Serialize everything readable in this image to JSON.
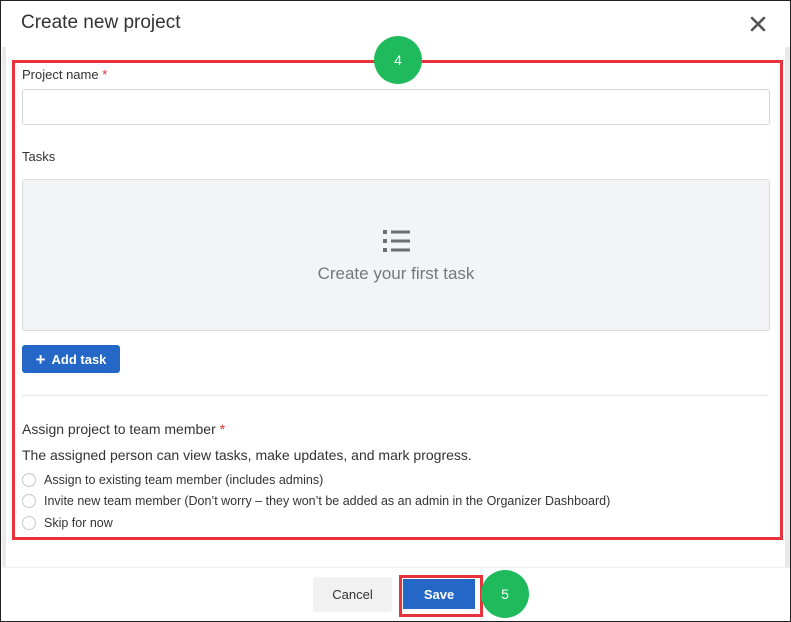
{
  "dialog": {
    "title": "Create new project",
    "close_icon": "close-icon"
  },
  "form": {
    "project_name_label": "Project name",
    "required_mark": "*",
    "project_name_value": "",
    "tasks_label": "Tasks",
    "tasks_empty_icon": "list-icon",
    "tasks_empty_text": "Create your first task",
    "add_task_label": "Add task",
    "add_task_icon": "plus-icon",
    "assign_label": "Assign project to team member",
    "assign_description": "The assigned person can view tasks, make updates, and mark progress.",
    "assign_options": [
      "Assign to existing team member (includes admins)",
      "Invite new team member (Don’t worry – they won’t be added as an admin in the Organizer Dashboard)",
      "Skip for now"
    ]
  },
  "footer": {
    "cancel_label": "Cancel",
    "save_label": "Save"
  },
  "annotations": {
    "step_form": "4",
    "step_save": "5"
  },
  "colors": {
    "primary": "#2467c7",
    "highlight": "#e8323c",
    "step_badge": "#1fba5b",
    "required": "#d9312c"
  }
}
